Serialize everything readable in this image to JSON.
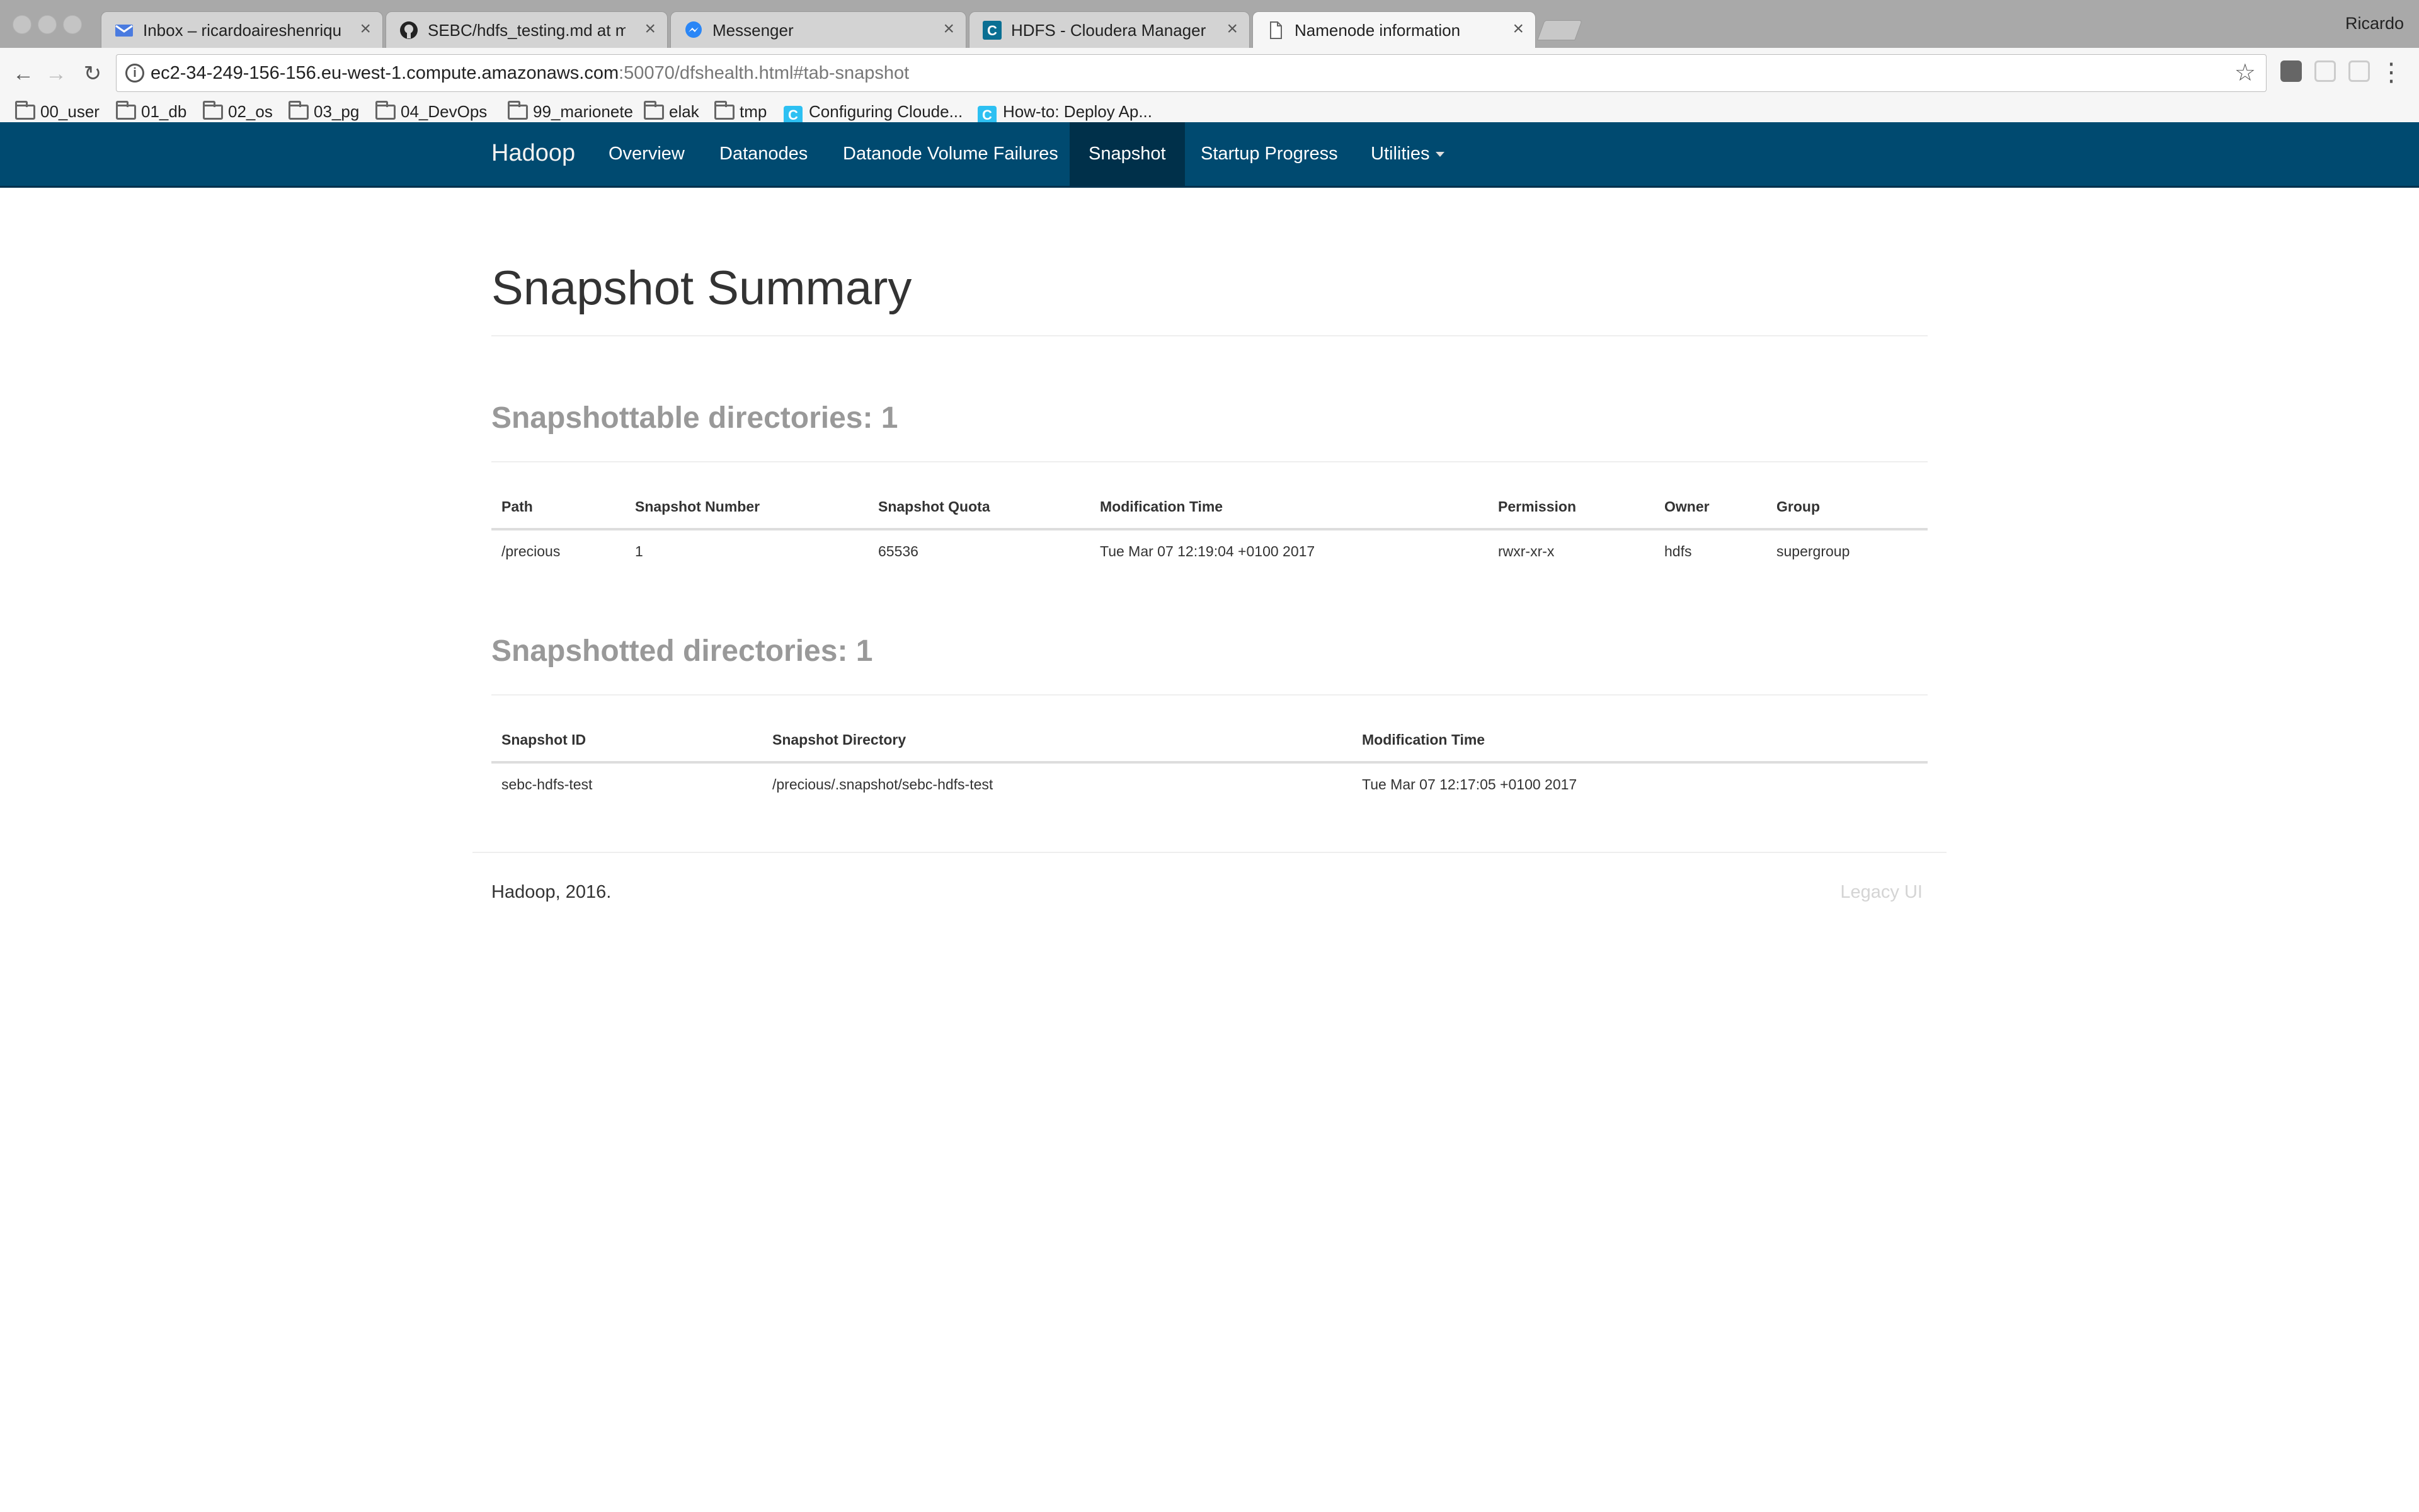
{
  "browser": {
    "tabs": [
      {
        "title": "Inbox – ricardoaireshenriques@",
        "icon": "mail-icon",
        "active": false
      },
      {
        "title": "SEBC/hdfs_testing.md at mast",
        "icon": "github-icon",
        "active": false
      },
      {
        "title": "Messenger",
        "icon": "messenger-icon",
        "active": false
      },
      {
        "title": "HDFS - Cloudera Manager",
        "icon": "cloudera-icon",
        "active": false
      },
      {
        "title": "Namenode information",
        "icon": "page-icon",
        "active": true
      }
    ],
    "profile_name": "Ricardo",
    "url_host": "ec2-34-249-156-156.eu-west-1.compute.amazonaws.com",
    "url_path": ":50070/dfshealth.html#tab-snapshot",
    "bookmarks": [
      {
        "label": "00_user",
        "type": "folder"
      },
      {
        "label": "01_db",
        "type": "folder"
      },
      {
        "label": "02_os",
        "type": "folder"
      },
      {
        "label": "03_pg",
        "type": "folder"
      },
      {
        "label": "04_DevOps",
        "type": "folder"
      },
      {
        "label": "99_marionete",
        "type": "folder"
      },
      {
        "label": "elak",
        "type": "folder"
      },
      {
        "label": "tmp",
        "type": "folder"
      },
      {
        "label": "Configuring Cloude...",
        "type": "link"
      },
      {
        "label": "How-to: Deploy Ap...",
        "type": "link"
      }
    ]
  },
  "navbar": {
    "brand": "Hadoop",
    "items": [
      {
        "label": "Overview"
      },
      {
        "label": "Datanodes"
      },
      {
        "label": "Datanode Volume Failures"
      },
      {
        "label": "Snapshot"
      },
      {
        "label": "Startup Progress"
      },
      {
        "label": "Utilities"
      }
    ],
    "active": "Snapshot"
  },
  "main": {
    "title": "Snapshot Summary",
    "snapshottable": {
      "heading": "Snapshottable directories: 1",
      "columns": [
        "Path",
        "Snapshot Number",
        "Snapshot Quota",
        "Modification Time",
        "Permission",
        "Owner",
        "Group"
      ],
      "rows": [
        [
          "/precious",
          "1",
          "65536",
          "Tue Mar 07 12:19:04 +0100 2017",
          "rwxr-xr-x",
          "hdfs",
          "supergroup"
        ]
      ]
    },
    "snapshotted": {
      "heading": "Snapshotted directories: 1",
      "columns": [
        "Snapshot ID",
        "Snapshot Directory",
        "Modification Time"
      ],
      "rows": [
        [
          "sebc-hdfs-test",
          "/precious/.snapshot/sebc-hdfs-test",
          "Tue Mar 07 12:17:05 +0100 2017"
        ]
      ]
    }
  },
  "footer": {
    "left": "Hadoop, 2016.",
    "right": "Legacy UI"
  }
}
